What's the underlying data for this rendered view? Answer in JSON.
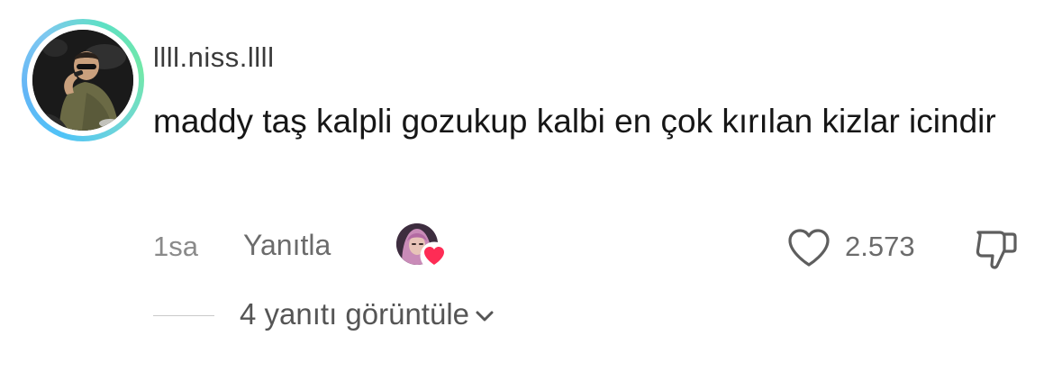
{
  "comment": {
    "username": "llll.niss.llll",
    "text": "maddy taş kalpli gozukup kalbi en çok kırılan kizlar icindir",
    "timestamp": "1sa",
    "reply_label": "Yanıtla",
    "like_count": "2.573",
    "view_replies_label": "4 yanıtı görüntüle",
    "creator_liked": true
  },
  "colors": {
    "heart_red": "#fe2c55",
    "text_primary": "#161616",
    "text_secondary": "#6b6b6b",
    "ring_gradient": [
      "#4fc3f7",
      "#72e8a8"
    ]
  },
  "icons": {
    "like": "heart-outline-icon",
    "dislike": "thumbs-down-icon",
    "chevron": "chevron-down-icon",
    "creator_heart": "heart-filled-icon"
  }
}
